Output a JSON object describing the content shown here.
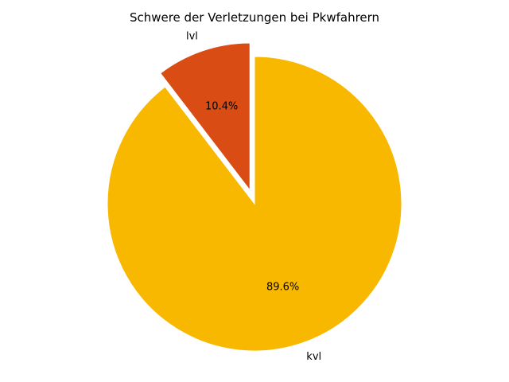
{
  "chart_data": {
    "type": "pie",
    "title": "Schwere der Verletzungen bei Pkwfahrern",
    "categories": [
      "lvl",
      "kvl"
    ],
    "values": [
      10.4,
      89.6
    ],
    "percent_labels": [
      "10.4%",
      "89.6%"
    ],
    "colors": [
      "#d94c13",
      "#f9b800"
    ],
    "exploded": [
      true,
      false
    ],
    "start": "12 o'clock",
    "direction": "counterclockwise",
    "legend": "none"
  }
}
